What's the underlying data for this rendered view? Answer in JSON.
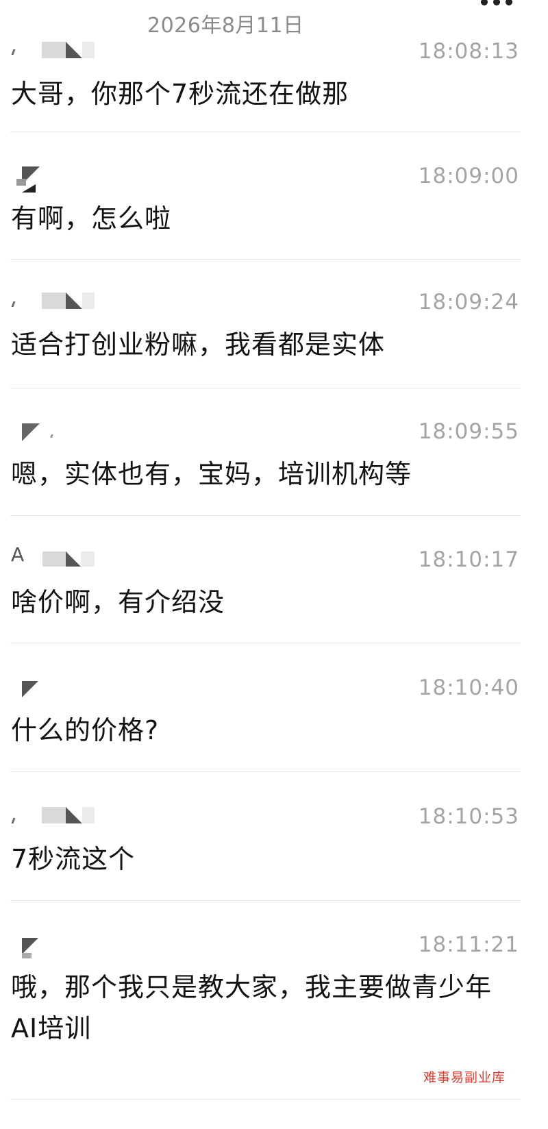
{
  "header": {
    "date": "2026年8月11日"
  },
  "messages": [
    {
      "sender": "",
      "time": "18:08:13",
      "text": "大哥，你那个7秒流还在做那"
    },
    {
      "sender": "",
      "time": "18:09:00",
      "text": "有啊，怎么啦"
    },
    {
      "sender": "",
      "time": "18:09:24",
      "text": "适合打创业粉嘛，我看都是实体"
    },
    {
      "sender": "",
      "time": "18:09:55",
      "text": "嗯，实体也有，宝妈，培训机构等"
    },
    {
      "sender": "A",
      "time": "18:10:17",
      "text": "啥价啊，有介绍没"
    },
    {
      "sender": "",
      "time": "18:10:40",
      "text": "什么的价格?"
    },
    {
      "sender": "",
      "time": "18:10:53",
      "text": "7秒流这个"
    },
    {
      "sender": "",
      "time": "18:11:21",
      "text": "哦，那个我只是教大家，我主要做青少年AI培训"
    }
  ],
  "watermark": "难事易副业库",
  "icons": {
    "more": "more-dots-icon",
    "avatar_mosaic": "redacted-name-icon"
  },
  "colors": {
    "timestamp": "#a4a4a4",
    "date": "#8a8a8a",
    "divider": "#e4e4e4",
    "watermark": "#e23a2c"
  }
}
